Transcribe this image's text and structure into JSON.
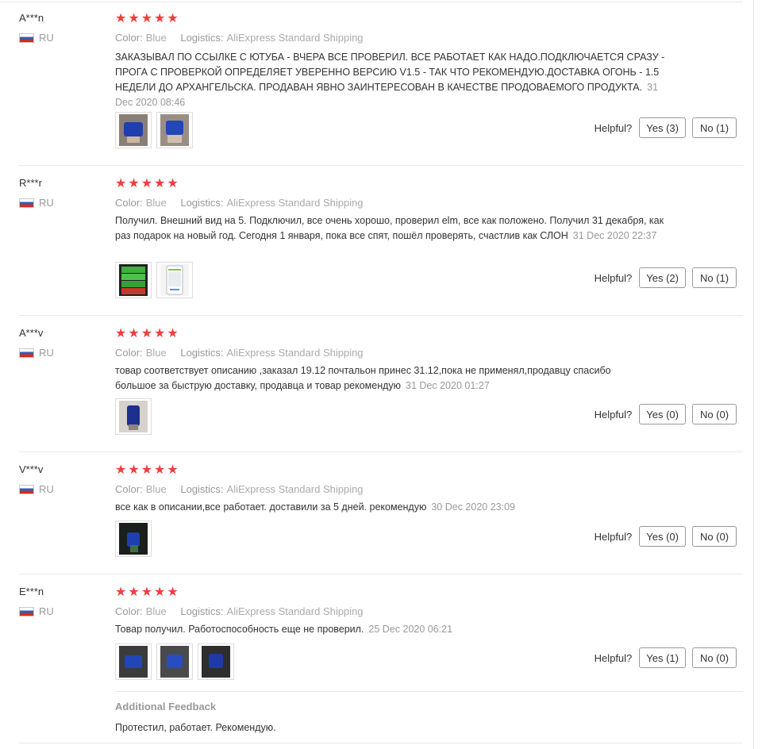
{
  "ui": {
    "helpful_label": "Helpful?",
    "color_key": "Color:",
    "logistics_key": "Logistics:",
    "star_glyph": "★",
    "star_color": "#ef3e3e"
  },
  "reviews": [
    {
      "user": "A***n",
      "country": "RU",
      "rating": 5,
      "color": "Blue",
      "logistics": "AliExpress Standard Shipping",
      "text": "ЗАКАЗЫВАЛ ПО ССЫЛКЕ С ЮТУБА - ВЧЕРА ВСЕ ПРОВЕРИЛ. ВСЕ РАБОТАЕТ КАК НАДО.ПОДКЛЮЧАЕТСЯ СРАЗУ - ПРОГА С ПРОВЕРКОЙ ОПРЕДЕЛЯЕТ УВЕРЕННО ВЕРСИЮ V1.5 - ТАК ЧТО РЕКОМЕНДУЮ.ДОСТАВКА ОГОНЬ - 1.5 НЕДЕЛИ ДО АРХАНГЕЛЬСКА. ПРОДАВАН ЯВНО ЗАИНТЕРЕСОВАН В КАЧЕСТВЕ ПРОДОВАЕМОГО ПРОДУКТА.",
      "date": "31 Dec 2020 08:46",
      "yes": "Yes (3)",
      "no": "No (1)",
      "photos": [
        "obd-adapter-in-hand-photo",
        "obd-adapter-in-hand-photo"
      ]
    },
    {
      "user": "R***r",
      "country": "RU",
      "rating": 5,
      "color": "Blue",
      "logistics": "AliExpress Standard Shipping",
      "text": "Получил. Внешний вид на 5. Подключил, все очень хорошо, проверил elm, все как положено. Получил 31 декабря, как раз подарок на новый год. Сегодня 1 января, пока все спят, пошёл проверять, счастлив как СЛОН",
      "date": "31 Dec 2020 22:37",
      "yes": "Yes (2)",
      "no": "No (1)",
      "photos": [
        "phone-app-screenshot",
        "phone-app-screenshot"
      ]
    },
    {
      "user": "A***v",
      "country": "RU",
      "rating": 5,
      "color": "Blue",
      "logistics": "AliExpress Standard Shipping",
      "text": "товар соответствует описанию ,заказал 19.12 почтальон принес 31.12,пока не применял,продавцу спасибо большое за быструю доставку, продавца и товар рекомендую",
      "date": "31 Dec 2020 01:27",
      "yes": "Yes (0)",
      "no": "No (0)",
      "photos": [
        "obd-adapter-photo"
      ]
    },
    {
      "user": "V***v",
      "country": "RU",
      "rating": 5,
      "color": "Blue",
      "logistics": "AliExpress Standard Shipping",
      "text": "все как в описании,все работает. доставили за 5 дней. рекомендую",
      "date": "30 Dec 2020 23:09",
      "yes": "Yes (0)",
      "no": "No (0)",
      "photos": [
        "obd-adapter-in-hand-photo"
      ]
    },
    {
      "user": "E***n",
      "country": "RU",
      "rating": 5,
      "color": "Blue",
      "logistics": "AliExpress Standard Shipping",
      "text": "Товар получил. Работоспособность еще не проверил.",
      "date": "25 Dec 2020 06:21",
      "yes": "Yes (1)",
      "no": "No (0)",
      "photos": [
        "obd-adapter-photo",
        "obd-adapter-photo",
        "obd-adapter-photo"
      ],
      "additional_feedback_title": "Additional Feedback",
      "additional_feedback_text": "Протестил, работает. Рекомендую."
    }
  ]
}
